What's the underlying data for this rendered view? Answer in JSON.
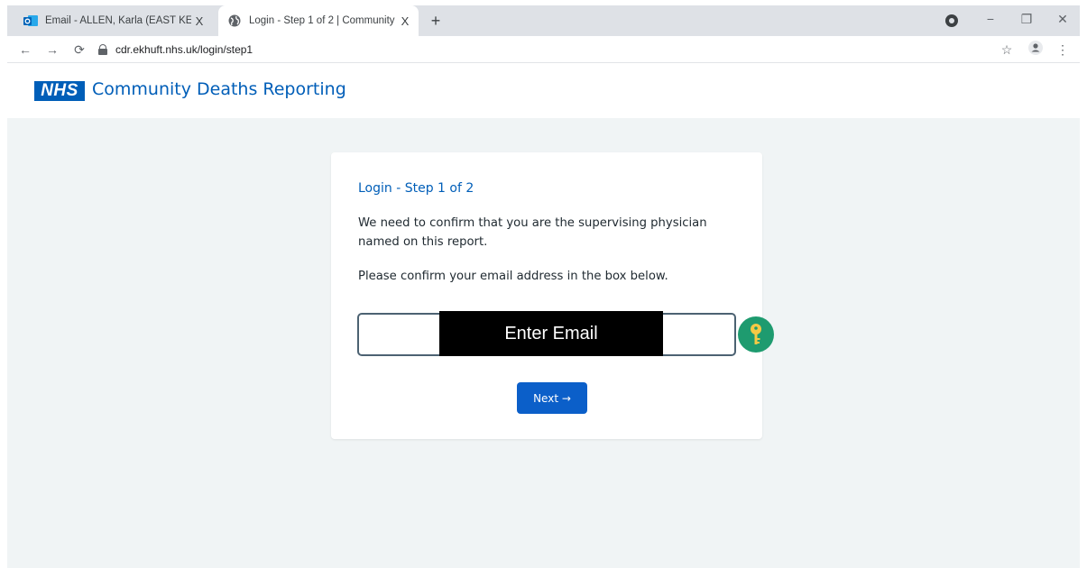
{
  "browser": {
    "tabs": [
      {
        "title": "Email - ALLEN, Karla (EAST KENT",
        "icon": "outlook-icon",
        "close": "X"
      },
      {
        "title": "Login - Step 1 of 2 | Community",
        "icon": "globe-icon",
        "close": "X"
      }
    ],
    "new_tab": "+",
    "url": "cdr.ekhuft.nhs.uk/login/step1",
    "window_controls": {
      "minimize": "−",
      "restore": "❐",
      "close": "✕"
    }
  },
  "site": {
    "logo_text": "NHS",
    "title": "Community Deaths Reporting"
  },
  "login": {
    "heading": "Login - Step 1 of 2",
    "paragraph1": "We need to confirm that you are the supervising physician named on this report.",
    "paragraph2": "Please confirm your email address in the box below.",
    "email_mask_text": "Enter Email",
    "next_label": "Next →"
  },
  "colors": {
    "nhs_blue": "#005eb8",
    "button_blue": "#0b5fc9",
    "page_background": "#f0f4f5",
    "key_badge": "#1e9b6f"
  }
}
